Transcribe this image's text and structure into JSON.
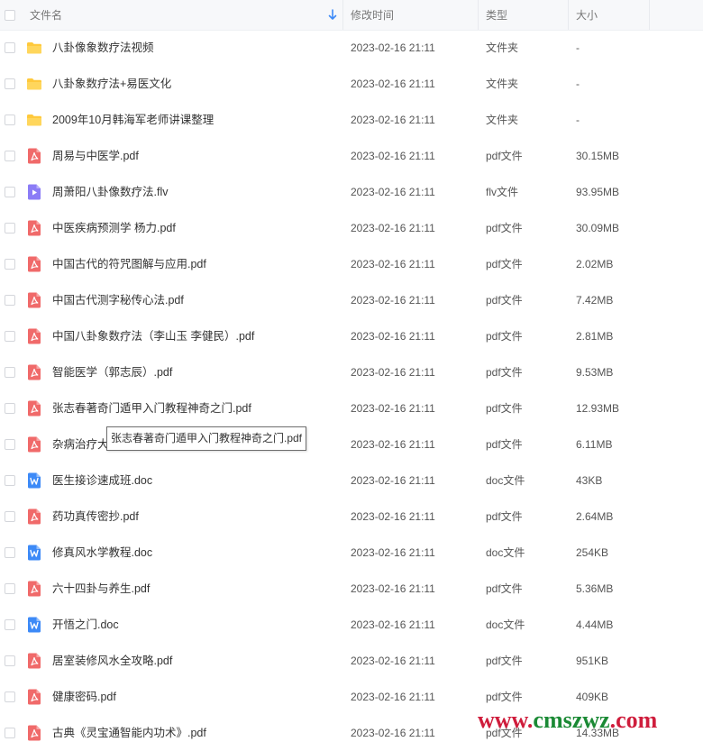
{
  "columns": {
    "name": "文件名",
    "modified": "修改时间",
    "type": "类型",
    "size": "大小"
  },
  "sort": {
    "column": "name",
    "direction": "descending-arrow"
  },
  "colors": {
    "folder": "#ffc93c",
    "pdf": "#f06a6a",
    "flv": "#8b7cf6",
    "doc": "#3d8af7",
    "sort_arrow": "#3d8af7"
  },
  "files": [
    {
      "name": "八卦像象数疗法视频",
      "modified": "2023-02-16 21:11",
      "type": "文件夹",
      "size": "-",
      "icon": "folder-icon"
    },
    {
      "name": "八卦象数疗法+易医文化",
      "modified": "2023-02-16 21:11",
      "type": "文件夹",
      "size": "-",
      "icon": "folder-icon"
    },
    {
      "name": "2009年10月韩海军老师讲课整理",
      "modified": "2023-02-16 21:11",
      "type": "文件夹",
      "size": "-",
      "icon": "folder-icon"
    },
    {
      "name": "周易与中医学.pdf",
      "modified": "2023-02-16 21:11",
      "type": "pdf文件",
      "size": "30.15MB",
      "icon": "pdf-icon"
    },
    {
      "name": "周萧阳八卦像数疗法.flv",
      "modified": "2023-02-16 21:11",
      "type": "flv文件",
      "size": "93.95MB",
      "icon": "video-icon"
    },
    {
      "name": "中医疾病预测学 杨力.pdf",
      "modified": "2023-02-16 21:11",
      "type": "pdf文件",
      "size": "30.09MB",
      "icon": "pdf-icon"
    },
    {
      "name": "中国古代的符咒图解与应用.pdf",
      "modified": "2023-02-16 21:11",
      "type": "pdf文件",
      "size": "2.02MB",
      "icon": "pdf-icon"
    },
    {
      "name": "中国古代测字秘传心法.pdf",
      "modified": "2023-02-16 21:11",
      "type": "pdf文件",
      "size": "7.42MB",
      "icon": "pdf-icon"
    },
    {
      "name": "中国八卦象数疗法（李山玉 李健民）.pdf",
      "modified": "2023-02-16 21:11",
      "type": "pdf文件",
      "size": "2.81MB",
      "icon": "pdf-icon"
    },
    {
      "name": "智能医学（郭志辰）.pdf",
      "modified": "2023-02-16 21:11",
      "type": "pdf文件",
      "size": "9.53MB",
      "icon": "pdf-icon"
    },
    {
      "name": "张志春著奇门遁甲入门教程神奇之门.pdf",
      "modified": "2023-02-16 21:11",
      "type": "pdf文件",
      "size": "12.93MB",
      "icon": "pdf-icon"
    },
    {
      "name": "杂病治疗大",
      "modified": "2023-02-16 21:11",
      "type": "pdf文件",
      "size": "6.11MB",
      "icon": "pdf-icon"
    },
    {
      "name": "医生接诊速成班.doc",
      "modified": "2023-02-16 21:11",
      "type": "doc文件",
      "size": "43KB",
      "icon": "word-icon"
    },
    {
      "name": "药功真传密抄.pdf",
      "modified": "2023-02-16 21:11",
      "type": "pdf文件",
      "size": "2.64MB",
      "icon": "pdf-icon"
    },
    {
      "name": "修真风水学教程.doc",
      "modified": "2023-02-16 21:11",
      "type": "doc文件",
      "size": "254KB",
      "icon": "word-icon"
    },
    {
      "name": "六十四卦与养生.pdf",
      "modified": "2023-02-16 21:11",
      "type": "pdf文件",
      "size": "5.36MB",
      "icon": "pdf-icon"
    },
    {
      "name": "开悟之门.doc",
      "modified": "2023-02-16 21:11",
      "type": "doc文件",
      "size": "4.44MB",
      "icon": "word-icon"
    },
    {
      "name": "居室装修风水全攻略.pdf",
      "modified": "2023-02-16 21:11",
      "type": "pdf文件",
      "size": "951KB",
      "icon": "pdf-icon"
    },
    {
      "name": "健康密码.pdf",
      "modified": "2023-02-16 21:11",
      "type": "pdf文件",
      "size": "409KB",
      "icon": "pdf-icon"
    },
    {
      "name": "古典《灵宝通智能内功术》.pdf",
      "modified": "2023-02-16 21:11",
      "type": "pdf文件",
      "size": "14.33MB",
      "icon": "pdf-icon"
    }
  ],
  "tooltip": {
    "text": "张志春著奇门遁甲入门教程神奇之门.pdf"
  },
  "watermark": {
    "part1": "www.",
    "part2": "cmszwz",
    "part3": ".com"
  }
}
